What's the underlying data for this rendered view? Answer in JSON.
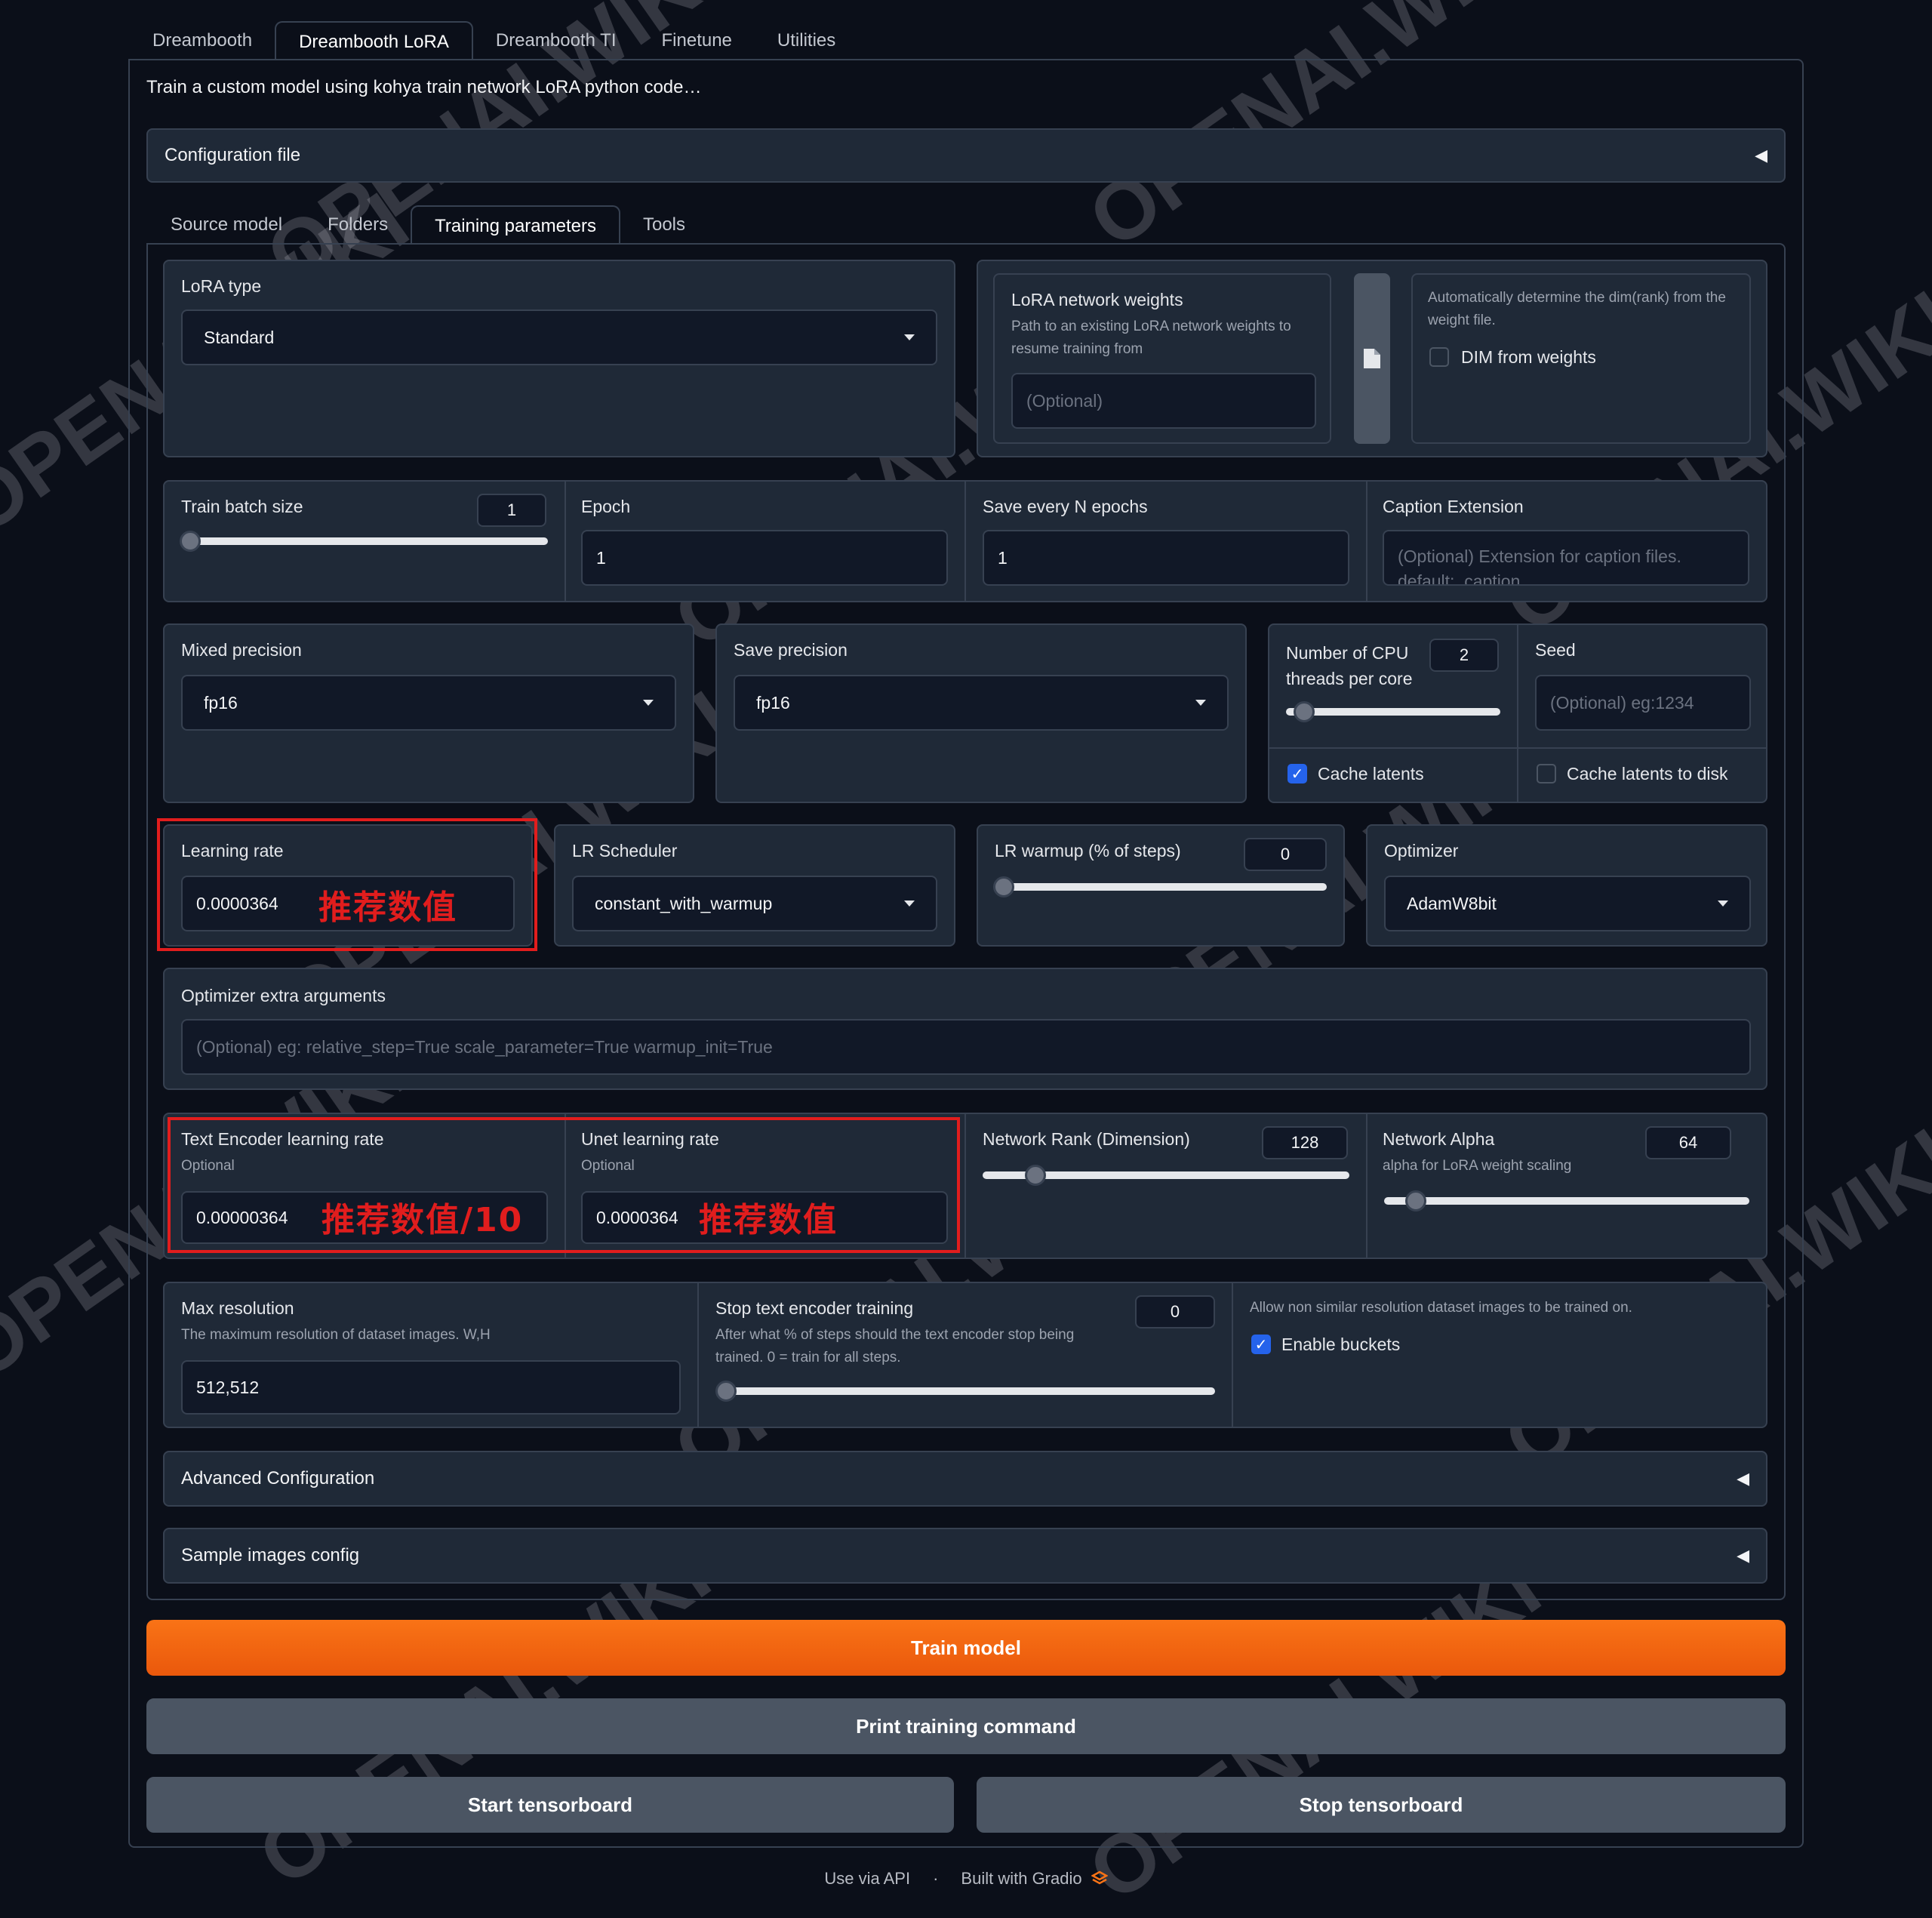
{
  "top_tabs": [
    "Dreambooth",
    "Dreambooth LoRA",
    "Dreambooth TI",
    "Finetune",
    "Utilities"
  ],
  "description": "Train a custom model using kohya train network LoRA python code…",
  "config_file": {
    "label": "Configuration file"
  },
  "sub_tabs": [
    "Source model",
    "Folders",
    "Training parameters",
    "Tools"
  ],
  "lora_type": {
    "label": "LoRA type",
    "value": "Standard"
  },
  "network_weights": {
    "label": "LoRA network weights",
    "sublabel": "Path to an existing LoRA network weights to resume training from",
    "placeholder": "(Optional)"
  },
  "dim_from_weights": {
    "info": "Automatically determine the dim(rank) from the weight file.",
    "label": "DIM from weights",
    "checked": false
  },
  "train_batch_size": {
    "label": "Train batch size",
    "value": "1",
    "fraction": 0.0
  },
  "epoch": {
    "label": "Epoch",
    "value": "1"
  },
  "save_every": {
    "label": "Save every N epochs",
    "value": "1"
  },
  "caption_ext": {
    "label": "Caption Extension",
    "placeholder_line1": "(Optional) Extension for caption files.",
    "placeholder_line2": "default: .caption"
  },
  "mixed_precision": {
    "label": "Mixed precision",
    "value": "fp16"
  },
  "save_precision": {
    "label": "Save precision",
    "value": "fp16"
  },
  "cpu_threads": {
    "label_line1": "Number of CPU",
    "label_line2": "threads per core",
    "value": "2",
    "fraction": 0.08
  },
  "seed": {
    "label": "Seed",
    "placeholder": "(Optional) eg:1234"
  },
  "cache_latents": {
    "label": "Cache latents",
    "checked": true
  },
  "cache_latents_disk": {
    "label": "Cache latents to disk",
    "checked": false
  },
  "learning_rate": {
    "label": "Learning rate",
    "value": "0.0000364",
    "note": "推荐数值"
  },
  "lr_scheduler": {
    "label": "LR Scheduler",
    "value": "constant_with_warmup"
  },
  "lr_warmup": {
    "label": "LR warmup (% of steps)",
    "value": "0",
    "fraction": 0.0
  },
  "optimizer": {
    "label": "Optimizer",
    "value": "AdamW8bit"
  },
  "optimizer_args": {
    "label": "Optimizer extra arguments",
    "placeholder": "(Optional) eg: relative_step=True scale_parameter=True warmup_init=True"
  },
  "te_lr": {
    "label": "Text Encoder learning rate",
    "sublabel": "Optional",
    "value": "0.00000364",
    "note": "推荐数值/10"
  },
  "unet_lr": {
    "label": "Unet learning rate",
    "sublabel": "Optional",
    "value": "0.0000364",
    "note": "推荐数值"
  },
  "network_rank": {
    "label": "Network Rank (Dimension)",
    "value": "128",
    "fraction": 0.125
  },
  "network_alpha": {
    "label": "Network Alpha",
    "sublabel": "alpha for LoRA weight scaling",
    "value": "64",
    "fraction": 0.0625
  },
  "max_resolution": {
    "label": "Max resolution",
    "sublabel": "The maximum resolution of dataset images. W,H",
    "value": "512,512"
  },
  "stop_te": {
    "label": "Stop text encoder training",
    "sublabel": "After what % of steps should the text encoder stop being trained. 0 = train for all steps.",
    "value": "0",
    "fraction": 0.0
  },
  "buckets": {
    "info": "Allow non similar resolution dataset images to be trained on.",
    "label": "Enable buckets",
    "checked": true
  },
  "advanced": {
    "label": "Advanced Configuration"
  },
  "sample_images": {
    "label": "Sample images config"
  },
  "buttons": {
    "train": "Train model",
    "print": "Print training command",
    "start_tb": "Start tensorboard",
    "stop_tb": "Stop tensorboard"
  },
  "footer": {
    "api": "Use via API",
    "sep": "·",
    "built": "Built with Gradio"
  },
  "watermark": "OPENAI.WIKI",
  "colors": {
    "accent": "#f97316",
    "highlight": "#e11d1d",
    "checkbox": "#2563eb"
  }
}
